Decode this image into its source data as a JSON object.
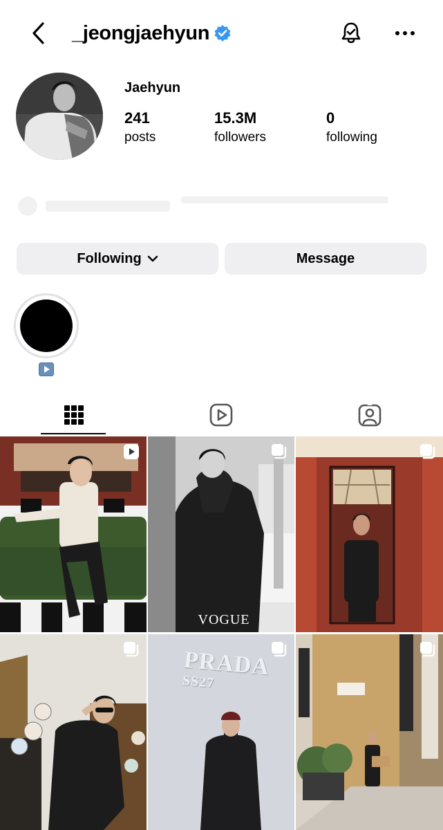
{
  "header": {
    "username": "_jeongjaehyun",
    "back_icon": "chevron-left-icon",
    "verified_icon": "verified-badge-icon",
    "notification_icon": "bell-check-icon",
    "more_icon": "more-horizontal-icon",
    "verified_color": "#3897f0"
  },
  "profile": {
    "display_name": "Jaehyun",
    "stats": [
      {
        "value": "241",
        "label": "posts"
      },
      {
        "value": "15.3M",
        "label": "followers"
      },
      {
        "value": "0",
        "label": "following"
      }
    ]
  },
  "actions": {
    "following_label": "Following",
    "message_label": "Message",
    "button_bg": "#efeff1"
  },
  "highlights": [
    {
      "label_icon": "play-emoji-icon"
    }
  ],
  "tabs": [
    {
      "icon": "grid-icon",
      "active": true
    },
    {
      "icon": "reels-icon",
      "active": false
    },
    {
      "icon": "tagged-icon",
      "active": false
    }
  ],
  "posts": [
    {
      "type": "reel",
      "overlay_icon": "reel-play-icon"
    },
    {
      "type": "carousel",
      "overlay_icon": "carousel-icon",
      "caption_text": "VOGUE"
    },
    {
      "type": "carousel",
      "overlay_icon": "carousel-icon"
    },
    {
      "type": "carousel",
      "overlay_icon": "carousel-icon"
    },
    {
      "type": "carousel",
      "overlay_icon": "carousel-icon",
      "caption_text": "PRADA",
      "caption_sub": "SS27"
    },
    {
      "type": "carousel",
      "overlay_icon": "carousel-icon"
    }
  ]
}
